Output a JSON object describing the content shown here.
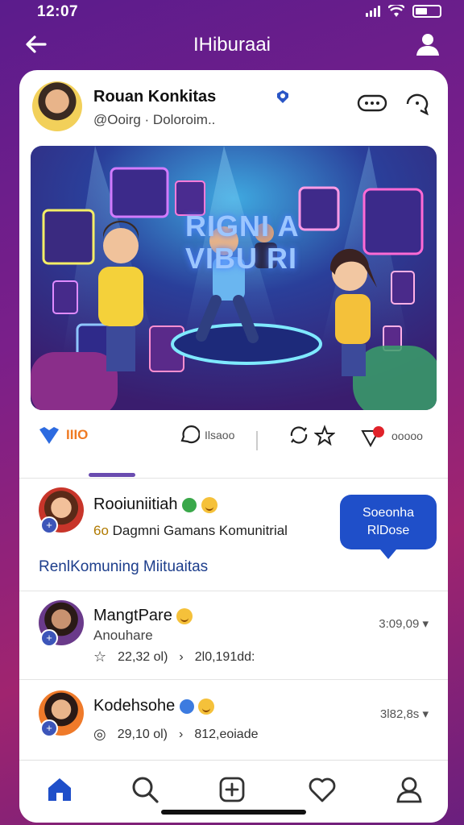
{
  "status_bar": {
    "time": "12:07"
  },
  "header": {
    "title": "IHiburaai"
  },
  "post": {
    "author_name": "Rouan Konkitas",
    "author_handle": "@Ooirg · Doloroim..",
    "hero_text_line1": "RIGNI A",
    "hero_text_line2": "VIBU RI"
  },
  "actions": {
    "like_count": "IIIO",
    "comment_count": "Ilsaoo",
    "share_count": "ooooo"
  },
  "comments": [
    {
      "name": "Rooiuniitiah",
      "text": "Dagmni Gamans Komunitrial",
      "prefix": "6o"
    },
    {
      "name": "MangtPare",
      "sub": "Anouhare",
      "stat1": "22,32 ol)",
      "stat2": "2l0,191dd:",
      "time": "3:09,09"
    },
    {
      "name": "Kodehsohe",
      "stat1": "29,10 ol)",
      "stat2": "812,eoiade",
      "time": "3l82,8s"
    }
  ],
  "cta": {
    "line1": "Soeonha",
    "line2": "RlDose"
  },
  "section_link": "RenlKomuning Miituaitas",
  "colors": {
    "accent": "#1f4fc9",
    "heart": "#2d6be0",
    "bg": "#7a1f8a"
  },
  "icons": {
    "back": "arrow-left-icon",
    "profile": "person-icon",
    "home": "home-icon",
    "search": "search-icon",
    "add": "plus-square-icon",
    "likes": "heart-icon",
    "account": "user-icon"
  }
}
